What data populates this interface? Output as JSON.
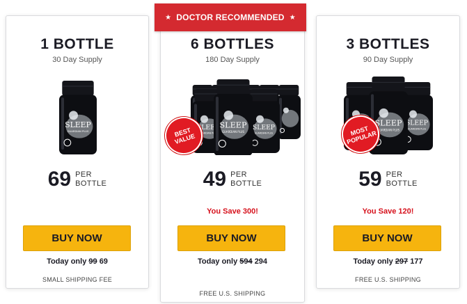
{
  "banner": {
    "label": "DOCTOR RECOMMENDED",
    "star": "★"
  },
  "colors": {
    "accent_red": "#d42a30",
    "button_yellow": "#f6b40e",
    "save_red": "#d6111c",
    "dark_text": "#1b1b24"
  },
  "cards": [
    {
      "id": "1",
      "title": "1 BOTTLE",
      "supply": "30 Day Supply",
      "bottles": 1,
      "badge": "",
      "price": "69",
      "per_line1": "PER",
      "per_line2": "BOTTLE",
      "save": "",
      "button": "BUY NOW",
      "today_prefix": "Today only",
      "old_price": "99",
      "new_price": "69",
      "shipping": "SMALL SHIPPING FEE"
    },
    {
      "id": "6",
      "title": "6 BOTTLES",
      "supply": "180 Day Supply",
      "bottles": 6,
      "badge": "BEST VALUE",
      "price": "49",
      "per_line1": "PER",
      "per_line2": "BOTTLE",
      "save": "You Save 300!",
      "button": "BUY NOW",
      "today_prefix": "Today only",
      "old_price": "594",
      "new_price": "294",
      "shipping": "FREE U.S. SHIPPING"
    },
    {
      "id": "3",
      "title": "3 BOTTLES",
      "supply": "90 Day Supply",
      "bottles": 3,
      "badge": "MOST POPULAR",
      "price": "59",
      "per_line1": "PER",
      "per_line2": "BOTTLE",
      "save": "You Save 120!",
      "button": "BUY NOW",
      "today_prefix": "Today only",
      "old_price": "297",
      "new_price": "177",
      "shipping": "FREE U.S. SHIPPING"
    }
  ],
  "product": {
    "label_line1": "SLEEP",
    "label_line2": "GUARDIAN PLUS",
    "icon": "sleep-supplement-bottle-icon"
  }
}
